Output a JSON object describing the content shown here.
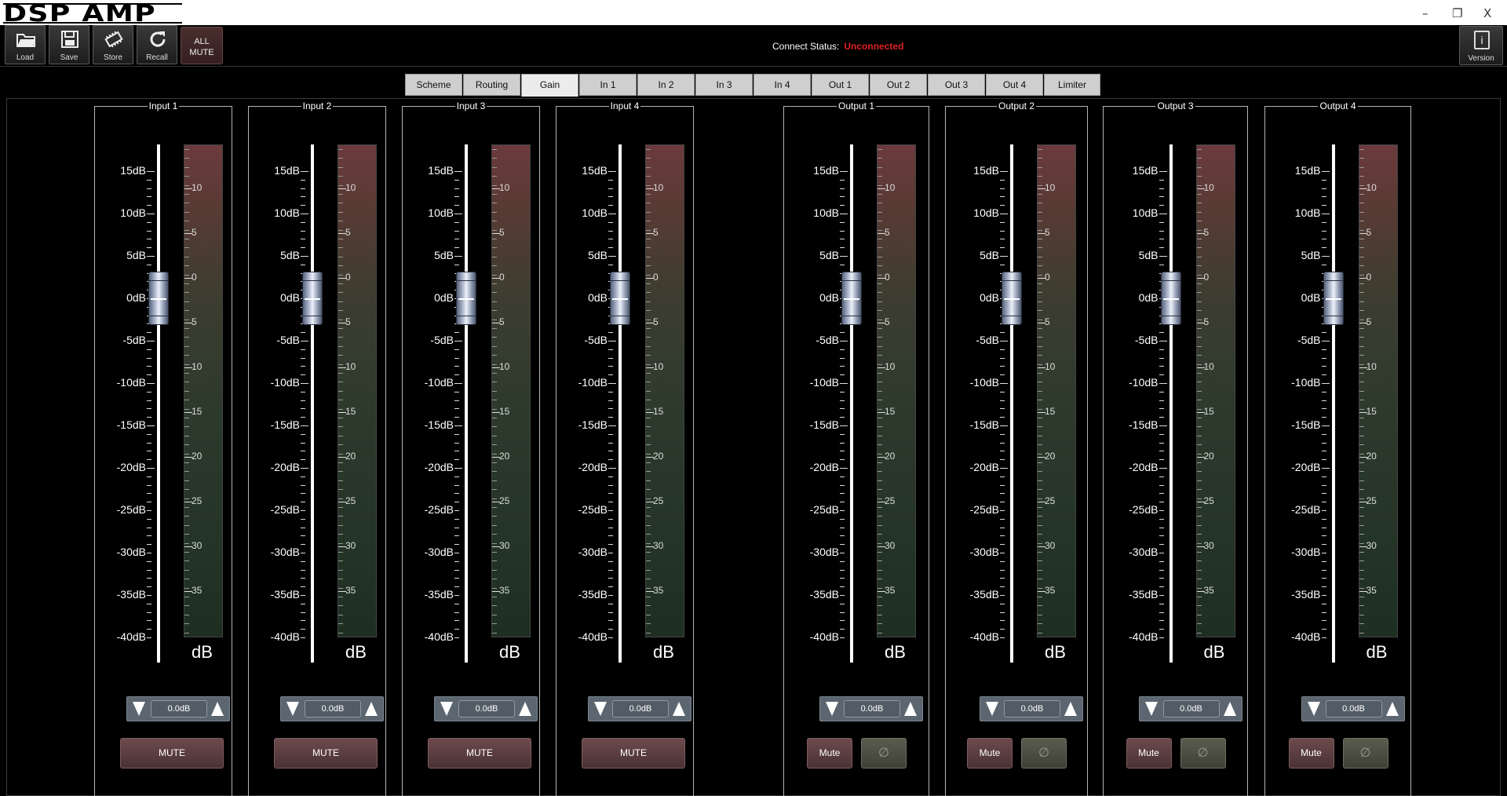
{
  "app": {
    "logo": "DSP AMP",
    "min": "–",
    "restore": "❐",
    "close": "X"
  },
  "toolbar": {
    "buttons": [
      {
        "label": "Load",
        "icon": "folder-icon"
      },
      {
        "label": "Save",
        "icon": "floppy-icon"
      },
      {
        "label": "Store",
        "icon": "chip-icon"
      },
      {
        "label": "Recall",
        "icon": "refresh-icon"
      }
    ],
    "all_mute": "ALL MUTE",
    "version": "Version",
    "version_icon": "i"
  },
  "connect": {
    "label": "Connect Status:",
    "status": "Unconnected",
    "status_color": "#e02020"
  },
  "tabs": [
    "Scheme",
    "Routing",
    "Gain",
    "In 1",
    "In 2",
    "In 3",
    "In 4",
    "Out 1",
    "Out 2",
    "Out 3",
    "Out 4",
    "Limiter"
  ],
  "active_tab": "Gain",
  "fader_scale": [
    "15dB",
    "10dB",
    "5dB",
    "0dB",
    "-5dB",
    "-10dB",
    "-15dB",
    "-20dB",
    "-25dB",
    "-30dB",
    "-35dB",
    "-40dB"
  ],
  "meter_scale": [
    "10",
    "5",
    "0",
    "5",
    "10",
    "15",
    "20",
    "25",
    "30",
    "35"
  ],
  "meter_unit": "dB",
  "inputs": [
    {
      "title": "Input 1",
      "gain": "0.0dB",
      "mute": "MUTE"
    },
    {
      "title": "Input 2",
      "gain": "0.0dB",
      "mute": "MUTE"
    },
    {
      "title": "Input 3",
      "gain": "0.0dB",
      "mute": "MUTE"
    },
    {
      "title": "Input 4",
      "gain": "0.0dB",
      "mute": "MUTE"
    }
  ],
  "outputs": [
    {
      "title": "Output 1",
      "gain": "0.0dB",
      "mute": "Mute",
      "phase": "∅"
    },
    {
      "title": "Output 2",
      "gain": "0.0dB",
      "mute": "Mute",
      "phase": "∅"
    },
    {
      "title": "Output 3",
      "gain": "0.0dB",
      "mute": "Mute",
      "phase": "∅"
    },
    {
      "title": "Output 4",
      "gain": "0.0dB",
      "mute": "Mute",
      "phase": "∅"
    }
  ]
}
